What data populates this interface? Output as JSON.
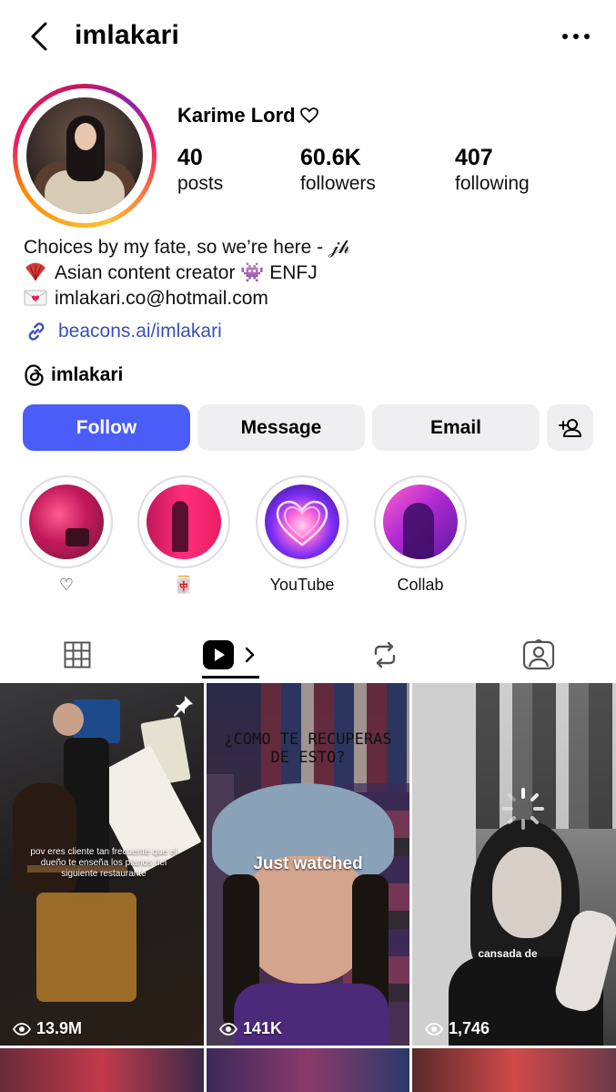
{
  "header": {
    "username": "imlakari"
  },
  "profile": {
    "display_name": "Karime Lord",
    "stats": {
      "posts": {
        "value": "40",
        "label": "posts"
      },
      "followers": {
        "value": "60.6K",
        "label": "followers"
      },
      "following": {
        "value": "407",
        "label": "following"
      }
    },
    "bio_lines": [
      "Choices by my fate, so we’re here - 𝒿𝒽",
      "Asian content creator 👾 ENFJ",
      "imlakari.co@hotmail.com"
    ],
    "link": "beacons.ai/imlakari",
    "threads_handle": "imlakari"
  },
  "actions": {
    "follow": "Follow",
    "message": "Message",
    "email": "Email"
  },
  "highlights": [
    {
      "label": "♡"
    },
    {
      "label": "🀄"
    },
    {
      "label": "YouTube"
    },
    {
      "label": "Collab"
    }
  ],
  "reels": [
    {
      "views": "13.9M",
      "caption": "pov eres cliente tan frecuente que el dueño te enseña los planos del siguiente restaurante",
      "pinned": true
    },
    {
      "views": "141K",
      "overlay_top": "¿COMO TE RECUPERAS DE ESTO?",
      "overlay_center": "Just watched"
    },
    {
      "views": "1,746",
      "caption": "cansada de"
    }
  ],
  "colors": {
    "accent": "#4a5df9",
    "link": "#3a4fb8",
    "button_bg": "#efeff2"
  }
}
